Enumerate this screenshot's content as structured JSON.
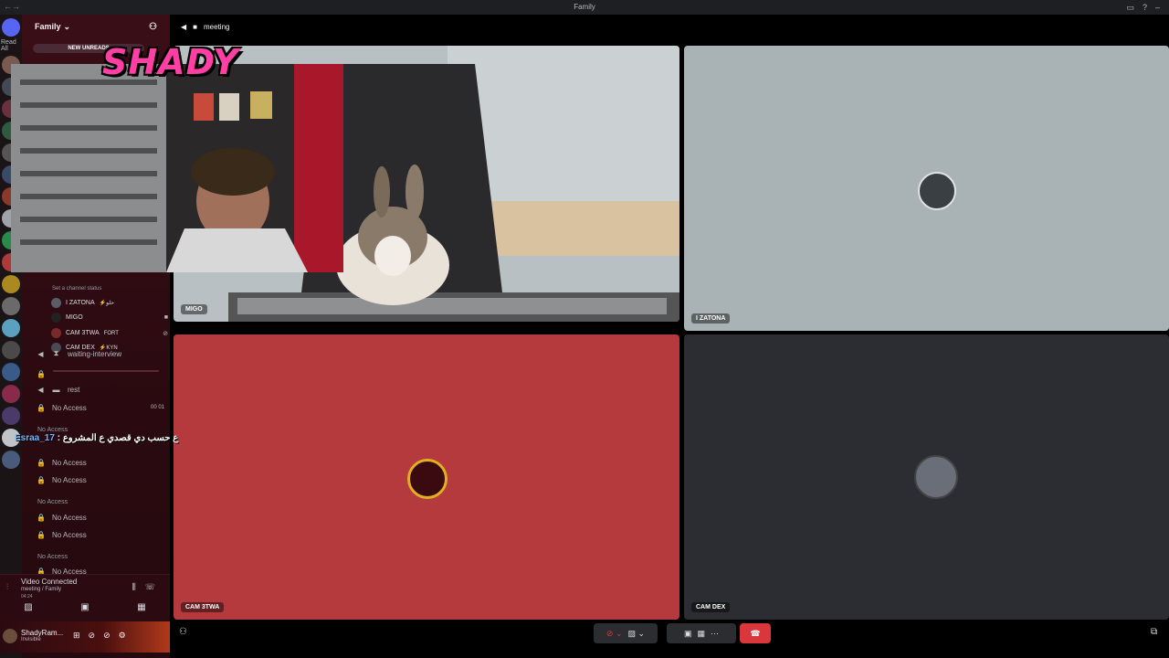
{
  "window": {
    "title": "Family"
  },
  "rail": {
    "read_all": "Read All"
  },
  "sidebar": {
    "server_name": "Family",
    "new_unreads": "NEW UNREADS",
    "set_status": "Set a channel status",
    "voice_users": [
      {
        "name": "I ZATONA",
        "tag": "⚡حلو"
      },
      {
        "name": "MIGO",
        "tag": ""
      },
      {
        "name": "CAM 3TWA",
        "tag": "FORT"
      },
      {
        "name": "CAM DEX",
        "tag": "⚡KYN"
      }
    ],
    "channels": [
      {
        "label": "waiting-interview"
      },
      {
        "label": "rest"
      },
      {
        "label": "No Access",
        "badge": "00 01"
      },
      {
        "label": "No Access"
      },
      {
        "label": "No Access"
      },
      {
        "label": "No Access"
      },
      {
        "label": "No Access"
      },
      {
        "label": "No Access"
      }
    ],
    "categories": [
      "No Access",
      "No Access",
      "No Access"
    ]
  },
  "voice_panel": {
    "title": "Video Connected",
    "channel_path": "meeting / Family",
    "timer": "04:24"
  },
  "user_panel": {
    "name": "ShadyRam...",
    "status": "Invisible"
  },
  "main": {
    "channel": "meeting",
    "tiles": [
      {
        "label": "MIGO",
        "color": "#b9c0c4"
      },
      {
        "label": "I ZATONA",
        "color": "#a9b2b5"
      },
      {
        "label": "CAM 3TWA",
        "color": "#b53a3d"
      },
      {
        "label": "CAM DEX",
        "color": "#2c2d33"
      }
    ],
    "end_call_color": "#da373c"
  },
  "overlay": {
    "logo_text": "SHADY",
    "chat_user": "Esraa_17",
    "chat_message": "ع حسب دي قصدي ع المشروع"
  }
}
